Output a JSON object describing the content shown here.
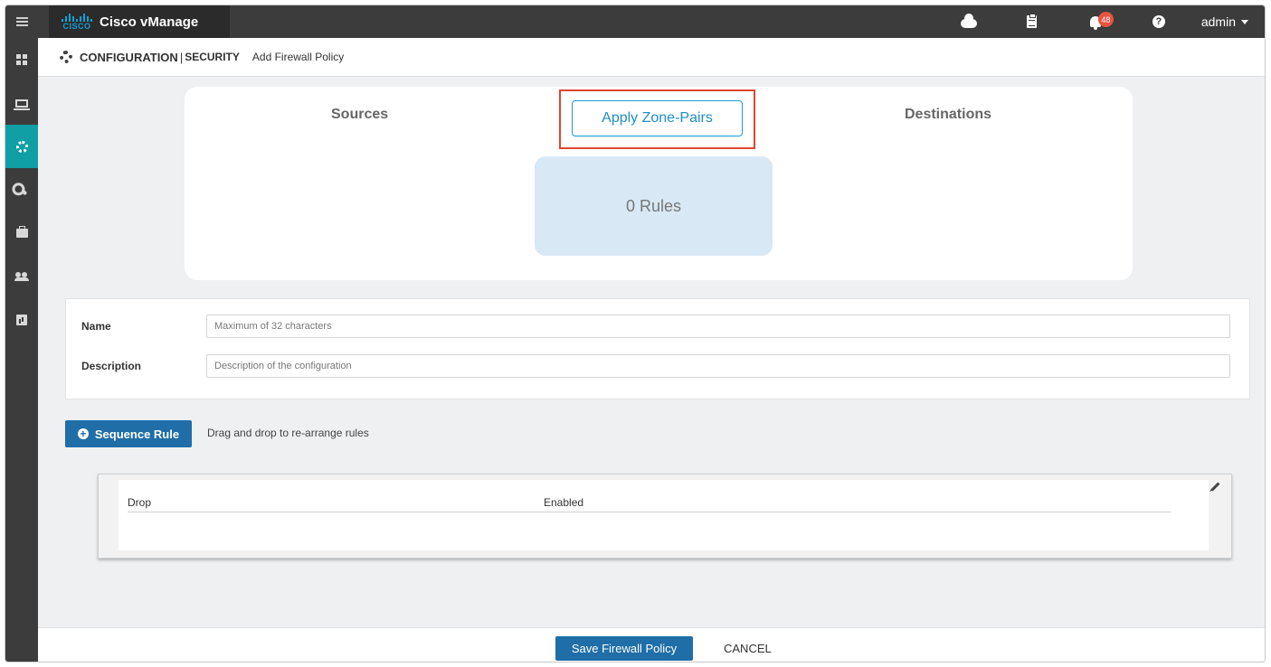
{
  "app": {
    "title": "Cisco vManage",
    "logo_word": "CISCO"
  },
  "topbar": {
    "notification_count": "48",
    "help_glyph": "?",
    "user": "admin",
    "icons": [
      "menu-icon",
      "cloud-icon",
      "clipboard-icon",
      "bell-icon",
      "help-icon",
      "chevron-down-icon"
    ]
  },
  "sidebar": {
    "items": [
      {
        "name": "dashboard",
        "icon": "dashboard-grid-icon",
        "active": false
      },
      {
        "name": "monitor",
        "icon": "laptop-icon",
        "active": false
      },
      {
        "name": "configuration",
        "icon": "gear-icon",
        "active": true
      },
      {
        "name": "tools",
        "icon": "wrench-icon",
        "active": false
      },
      {
        "name": "maintenance",
        "icon": "briefcase-icon",
        "active": false
      },
      {
        "name": "administration",
        "icon": "users-icon",
        "active": false
      },
      {
        "name": "analytics",
        "icon": "chart-icon",
        "active": false
      }
    ],
    "active_color": "#0f9fa5"
  },
  "breadcrumb": {
    "section": "CONFIGURATION",
    "separator": "|",
    "subsection": "SECURITY",
    "page": "Add Firewall Policy"
  },
  "zone": {
    "sources_label": "Sources",
    "apply_label": "Apply Zone-Pairs",
    "destinations_label": "Destinations",
    "rules_label": "0 Rules"
  },
  "form": {
    "name_label": "Name",
    "name_placeholder": "Maximum of 32 characters",
    "name_value": "",
    "description_label": "Description",
    "description_placeholder": "Description of the configuration",
    "description_value": ""
  },
  "sequence": {
    "button_label": "Sequence Rule",
    "plus_glyph": "+",
    "hint": "Drag and drop to re-arrange rules",
    "rules": [
      {
        "action": "Drop",
        "status": "Enabled"
      }
    ]
  },
  "footer": {
    "save_label": "Save Firewall Policy",
    "cancel_label": "CANCEL"
  },
  "colors": {
    "primary_button": "#1f6ea8",
    "highlight_border": "#e0452e",
    "apply_text": "#1e8fc8",
    "badge": "#e8523f"
  }
}
